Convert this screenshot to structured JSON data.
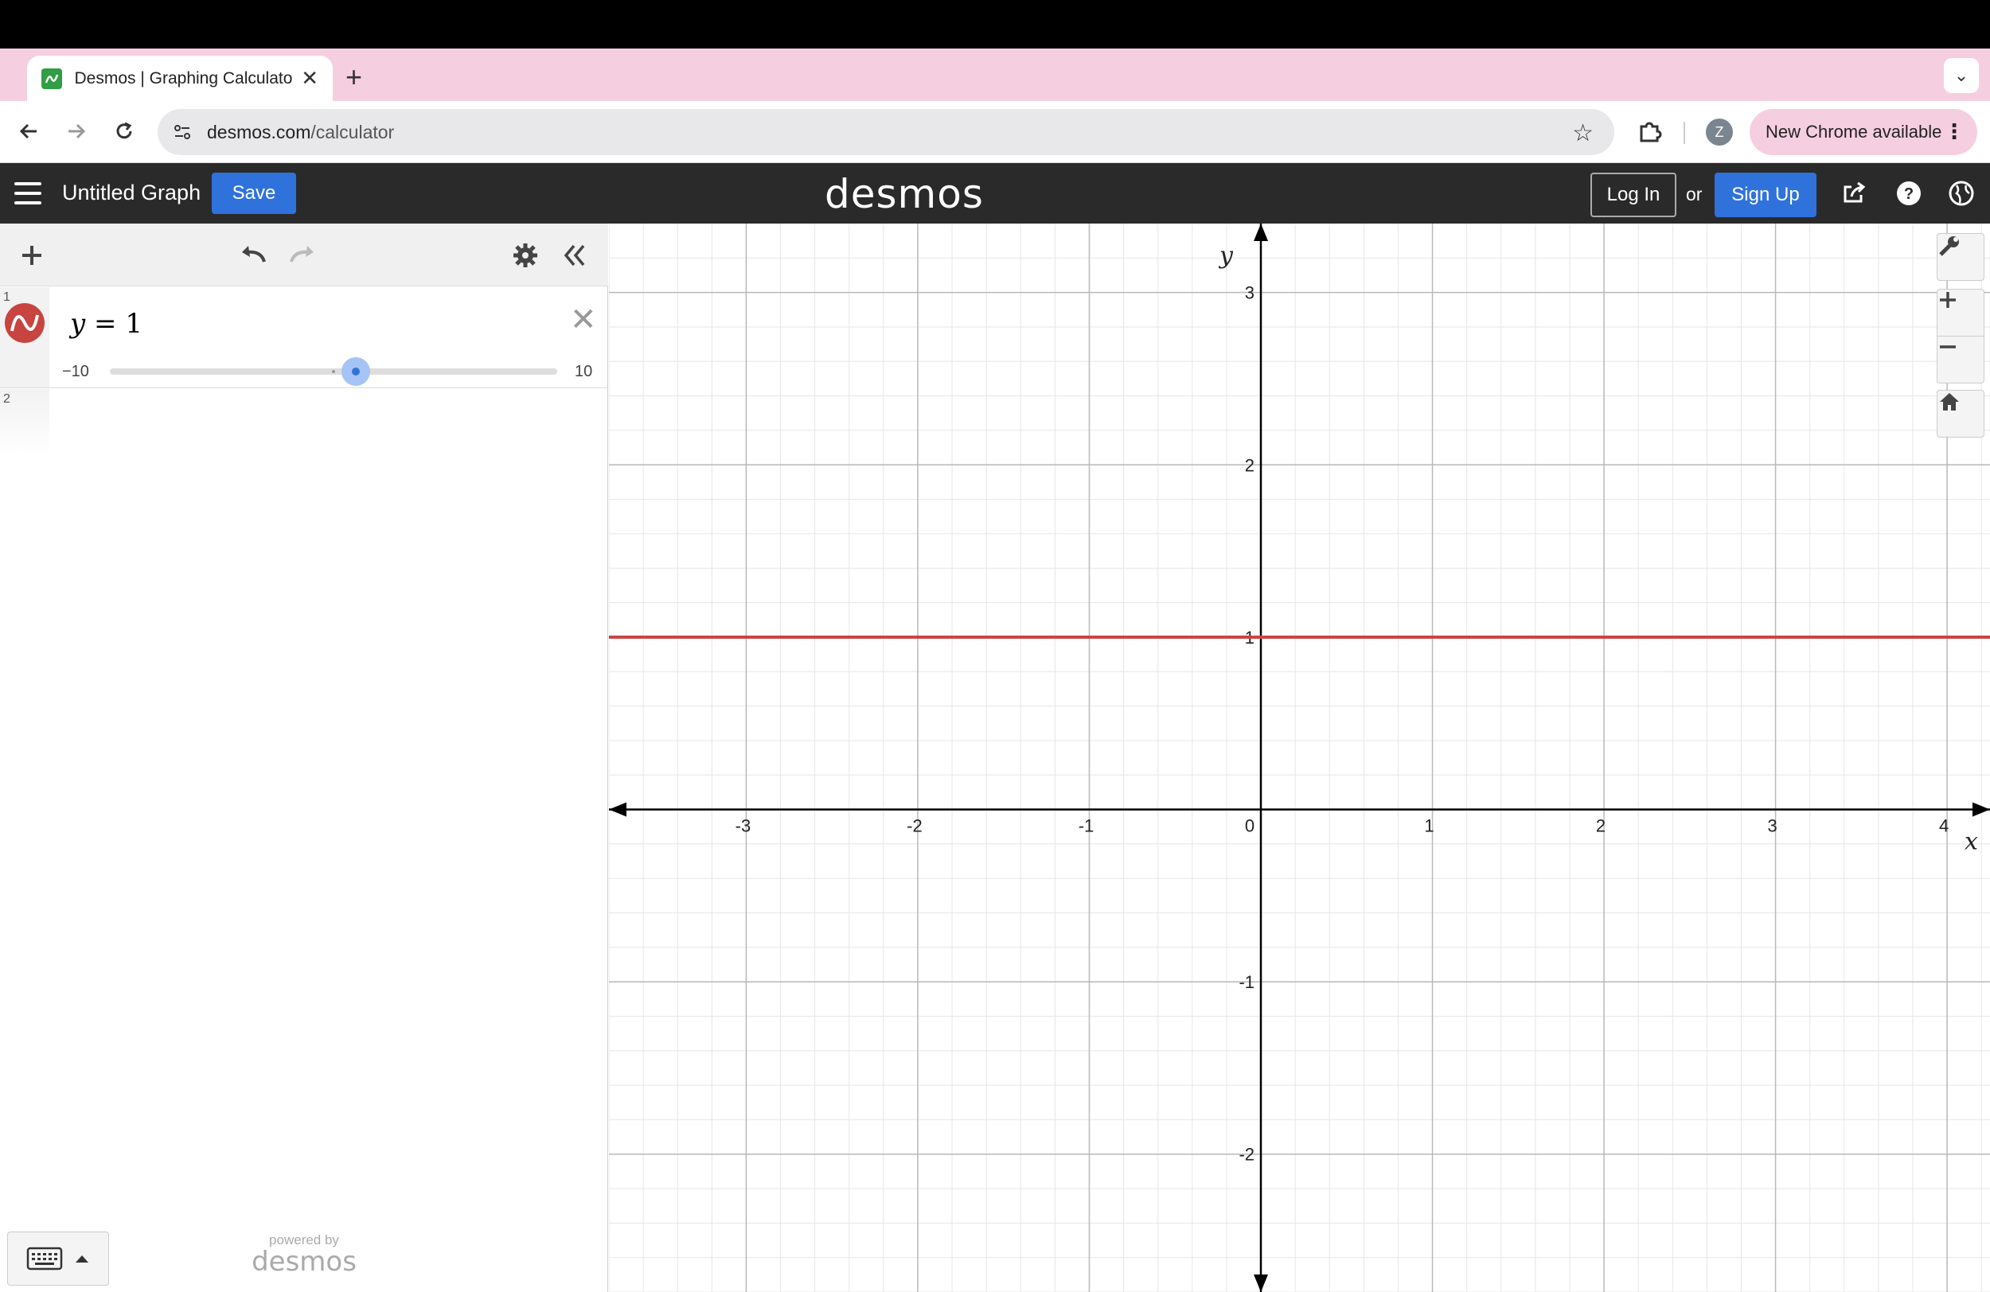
{
  "browser": {
    "tab_title": "Desmos | Graphing Calculator",
    "url_host": "desmos.com",
    "url_path": "/calculator",
    "profile_initial": "Z",
    "update_label": "New Chrome available"
  },
  "header": {
    "graph_title": "Untitled Graph",
    "save_label": "Save",
    "logo_text": "desmos",
    "login_label": "Log In",
    "or_text": "or",
    "signup_label": "Sign Up"
  },
  "expressions": [
    {
      "number": "1",
      "latex_var": "y",
      "latex_eq": " = ",
      "latex_val": "1",
      "color": "#c74440",
      "slider": {
        "min_label": "−10",
        "max_label": "10",
        "min": -10,
        "max": 10,
        "value": 1
      }
    },
    {
      "number": "2"
    }
  ],
  "footer": {
    "powered_by": "powered by",
    "powered_logo": "desmos"
  },
  "chart_data": {
    "type": "line",
    "xlabel": "x",
    "ylabel": "y",
    "xlim": [
      -3.8,
      4.25
    ],
    "ylim": [
      -2.8,
      3.4
    ],
    "x_ticks": [
      -3,
      -2,
      -1,
      0,
      1,
      2,
      3,
      4
    ],
    "y_ticks": [
      -2,
      -1,
      1,
      2,
      3
    ],
    "grid": true,
    "series": [
      {
        "equation": "y = 1",
        "color": "#c74440",
        "x": [
          -3.8,
          4.25
        ],
        "y": [
          1,
          1
        ]
      }
    ]
  }
}
